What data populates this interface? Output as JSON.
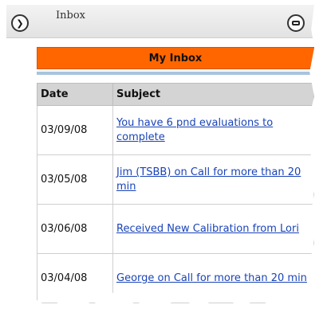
{
  "window": {
    "title": "Inbox"
  },
  "panel": {
    "header": "My Inbox"
  },
  "table": {
    "columns": [
      "Date",
      "Subject"
    ],
    "rows": [
      {
        "date": "03/09/08",
        "subject": "You have 6 pnd evaluations to complete"
      },
      {
        "date": "03/05/08",
        "subject": "Jim (TSBB) on Call for more than 20 min"
      },
      {
        "date": "03/06/08",
        "subject": "Received New Calibration from Lori"
      },
      {
        "date": "03/04/08",
        "subject": "George on Call for more than 20 min"
      }
    ]
  },
  "colors": {
    "header_bg": "#ff6600",
    "link": "#1a44b8",
    "column_header_bg": "#d4d4d4",
    "accent_line": "#a8c4dd"
  },
  "icons": [
    "chevron-right-icon",
    "close-icon"
  ]
}
